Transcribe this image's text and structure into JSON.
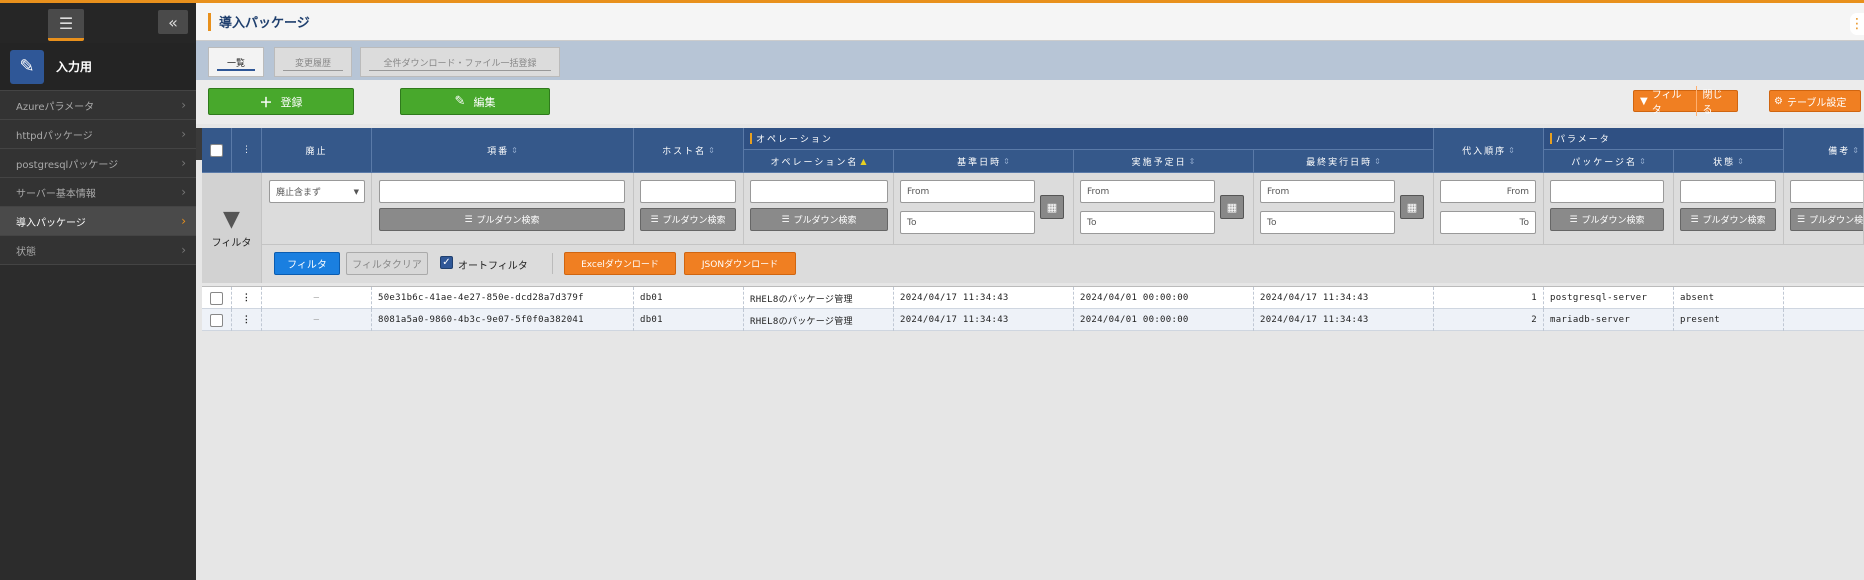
{
  "sidebar": {
    "menu_label": "入力用",
    "items": [
      {
        "label": "Azureパラメータ"
      },
      {
        "label": "httpdパッケージ"
      },
      {
        "label": "postgresqlパッケージ"
      },
      {
        "label": "サーバー基本情報"
      },
      {
        "label": "導入パッケージ"
      },
      {
        "label": "状態"
      }
    ]
  },
  "header": {
    "title": "導入パッケージ"
  },
  "tabs": [
    {
      "label": "一覧"
    },
    {
      "label": "変更履歴"
    },
    {
      "label": "全件ダウンロード・ファイル一括登録"
    }
  ],
  "toolbar": {
    "register": "登録",
    "edit": "編集",
    "filter": "フィルタ",
    "close": "閉じる",
    "table_settings": "テーブル設定"
  },
  "columns": {
    "discard": "廃止",
    "item_no": "項番",
    "host": "ホスト名",
    "operation_group": "オペレーション",
    "operation_name": "オペレーション名",
    "base_datetime": "基準日時",
    "scheduled_date": "実施予定日",
    "last_exec": "最終実行日時",
    "order": "代入順序",
    "param_group": "パラメータ",
    "package_name": "パッケージ名",
    "state": "状態",
    "remarks": "備考"
  },
  "filter": {
    "label": "フィルタ",
    "discard_select": "廃止含まず",
    "pulldown": "プルダウン検索",
    "from": "From",
    "to": "To",
    "filter_btn": "フィルタ",
    "clear_btn": "フィルタクリア",
    "auto_filter": "オートフィルタ",
    "excel_btn": "Excelダウンロード",
    "json_btn": "JSONダウンロード"
  },
  "rows": [
    {
      "discard": "—",
      "item_no": "50e31b6c-41ae-4e27-850e-dcd28a7d379f",
      "host": "db01",
      "operation": "RHEL8のパッケージ管理",
      "base": "2024/04/17 11:34:43",
      "scheduled": "2024/04/01 00:00:00",
      "last": "2024/04/17 11:34:43",
      "order": "1",
      "package": "postgresql-server",
      "state": "absent"
    },
    {
      "discard": "—",
      "item_no": "8081a5a0-9860-4b3c-9e07-5f0f0a382041",
      "host": "db01",
      "operation": "RHEL8のパッケージ管理",
      "base": "2024/04/17 11:34:43",
      "scheduled": "2024/04/01 00:00:00",
      "last": "2024/04/17 11:34:43",
      "order": "2",
      "package": "mariadb-server",
      "state": "present"
    }
  ],
  "colors": {
    "accent": "#e8901c",
    "header": "#35588a",
    "green": "#48a82c",
    "orange": "#f07f22"
  }
}
